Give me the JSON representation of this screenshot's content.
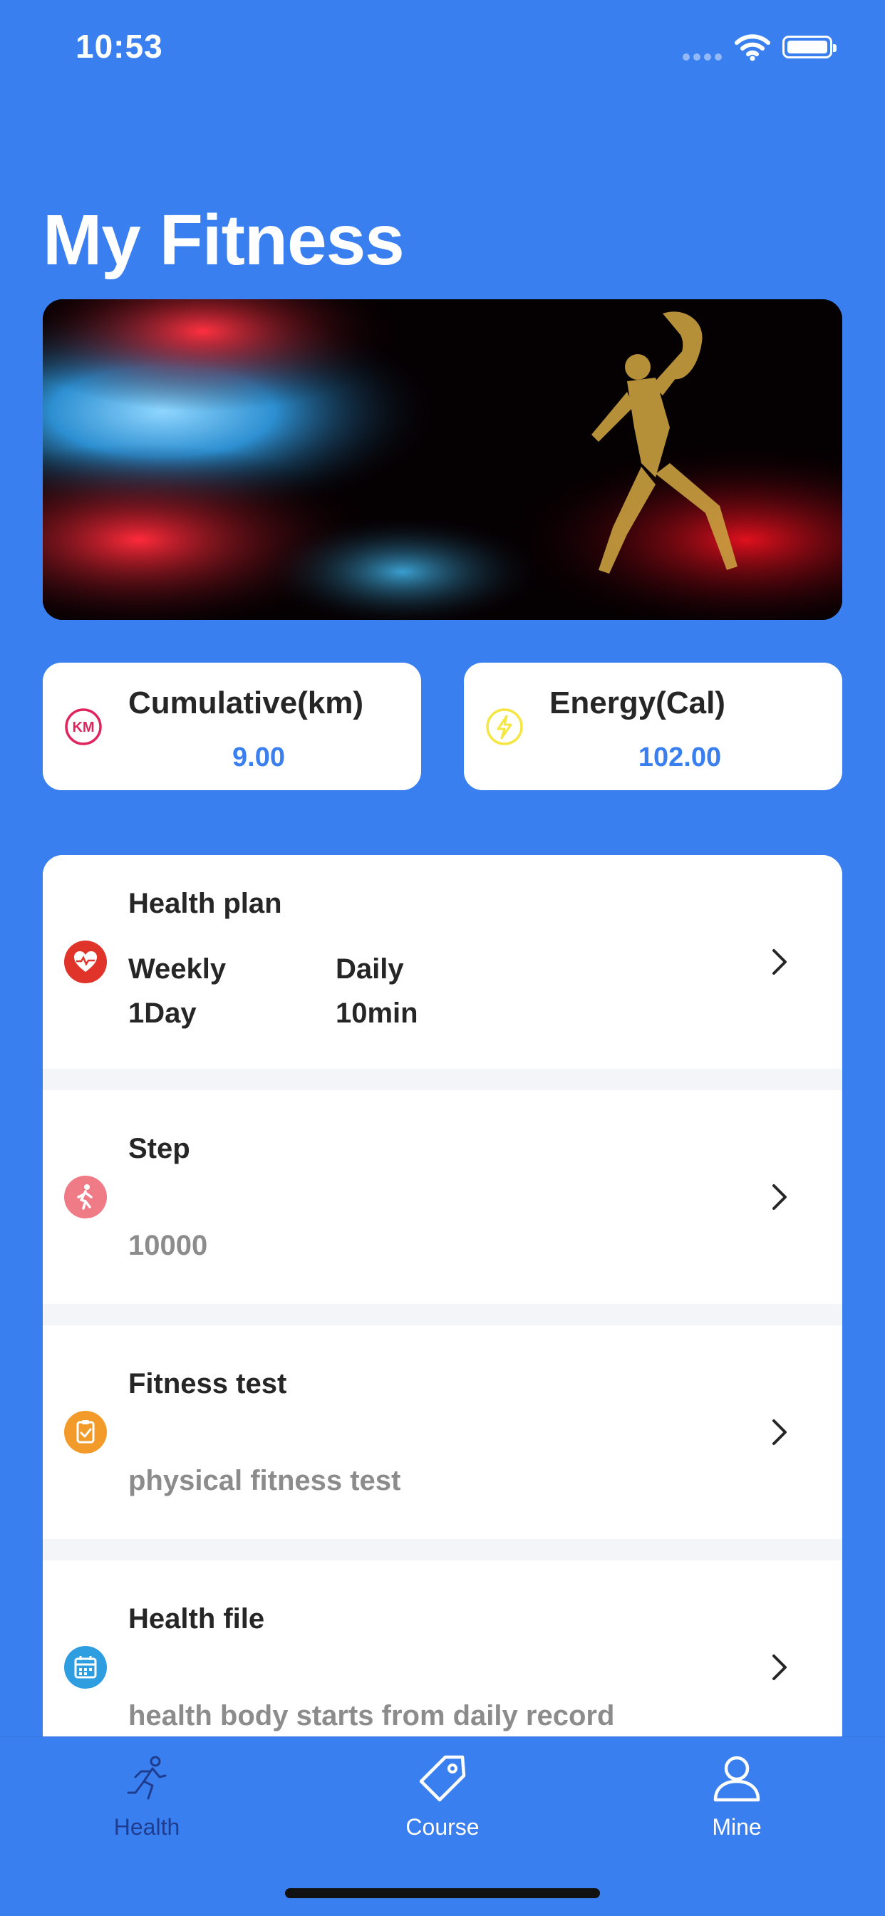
{
  "status_bar": {
    "time": "10:53"
  },
  "page_title": "My Fitness",
  "stats": [
    {
      "label": "Cumulative(km)",
      "value": "9.00",
      "icon": "km-icon",
      "icon_color": "#e0245e",
      "icon_text": "KM"
    },
    {
      "label": "Energy(Cal)",
      "value": "102.00",
      "icon": "lightning-icon",
      "icon_color": "#f5e642"
    }
  ],
  "health_plan": {
    "title": "Health plan",
    "weekly_label": "Weekly",
    "weekly_value": "1Day",
    "daily_label": "Daily",
    "daily_value": "10min",
    "icon": "heart-rate-icon",
    "icon_color": "#e0342a"
  },
  "rows": [
    {
      "title": "Step",
      "subtitle": "10000",
      "icon": "walking-icon",
      "icon_color": "#ee7b86"
    },
    {
      "title": "Fitness test",
      "subtitle": "physical fitness test",
      "icon": "clipboard-icon",
      "icon_color": "#f29b2a"
    },
    {
      "title": "Health file",
      "subtitle": "health body starts from daily record",
      "icon": "calendar-icon",
      "icon_color": "#2f9ee0"
    }
  ],
  "tabs": [
    {
      "label": "Health",
      "icon": "runner-icon",
      "active": true,
      "color": "#1f3d8f"
    },
    {
      "label": "Course",
      "icon": "tag-icon",
      "active": false,
      "color": "#ffffff"
    },
    {
      "label": "Mine",
      "icon": "person-icon",
      "active": false,
      "color": "#ffffff"
    }
  ],
  "colors": {
    "accent": "#3a7ff0",
    "value_text": "#3a7ff0",
    "title_text": "#262626",
    "sub_text": "#8c8c8c"
  }
}
